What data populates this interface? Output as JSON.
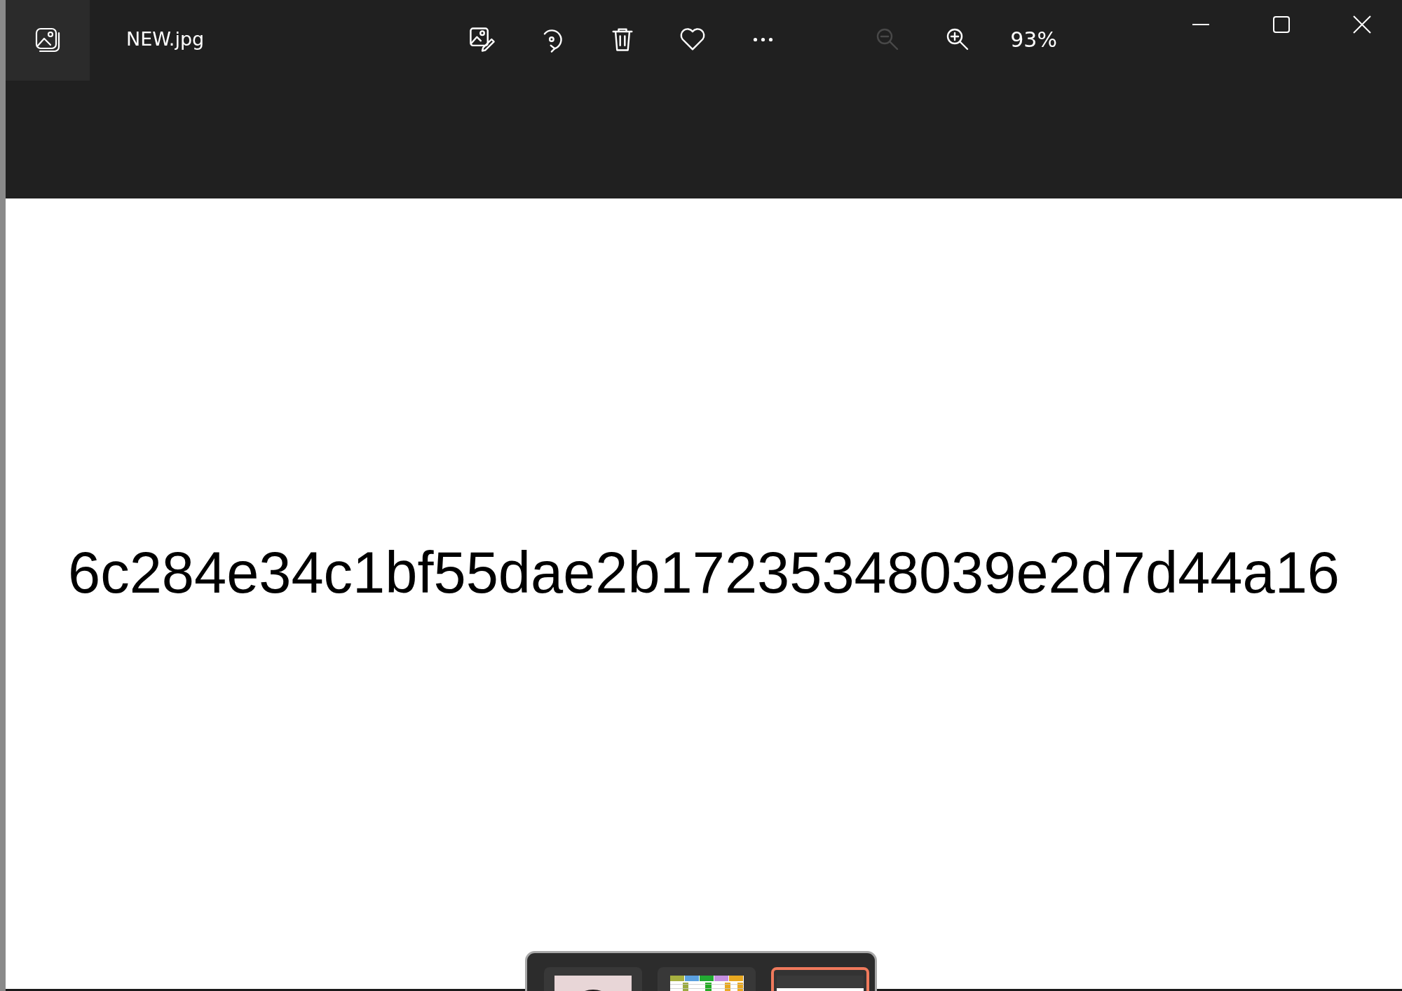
{
  "window": {
    "title": "NEW.jpg"
  },
  "toolbar": [
    {
      "kind": "edit"
    },
    {
      "kind": "rotate"
    },
    {
      "kind": "delete"
    },
    {
      "kind": "favorite"
    },
    {
      "kind": "more"
    }
  ],
  "zoom": {
    "zoom_out_disabled": true,
    "level_text": "93%"
  },
  "image": {
    "text": "6c284e34c1bf55dae2b17235348039e2d7d44a16"
  },
  "filmstrip": [
    {
      "kind": "portrait",
      "selected": false
    },
    {
      "kind": "spreadsheet",
      "selected": false
    },
    {
      "kind": "blank",
      "selected": true
    }
  ]
}
